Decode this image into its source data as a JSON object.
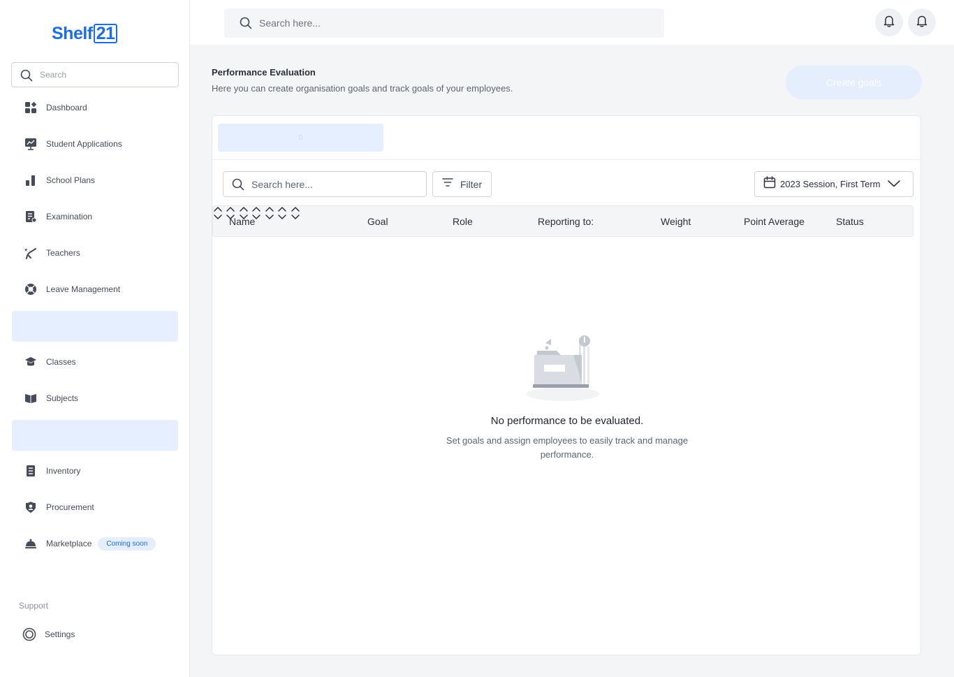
{
  "app": {
    "logo_text": "Shelf",
    "logo_box": "21"
  },
  "sidebar": {
    "search_placeholder": "Search",
    "items": [
      {
        "label": "Dashboard"
      },
      {
        "label": "Student Applications"
      },
      {
        "label": "School Plans"
      },
      {
        "label": "Examination"
      },
      {
        "label": "Teachers"
      },
      {
        "label": "Leave Management"
      },
      {
        "label": "Classes"
      },
      {
        "label": "Subjects"
      },
      {
        "label": "Inventory"
      },
      {
        "label": "Procurement"
      },
      {
        "label": "Marketplace",
        "badge": "Coming soon"
      }
    ],
    "support_label": "Support",
    "settings_label": "Settings"
  },
  "topbar": {
    "search_placeholder": "Search here..."
  },
  "page": {
    "title": "Performance Evaluation",
    "subtitle": "Here you can create organisation goals and track goals of your employees.",
    "create_button": "Create goals"
  },
  "card": {
    "tab_label": "0",
    "search_placeholder": "Search here...",
    "filter_label": "Filter",
    "session_label": "2023 Session, First Term",
    "columns": [
      "Name",
      "Goal",
      "Role",
      "Reporting to:",
      "Weight",
      "Point Average",
      "Status"
    ],
    "empty_title": "No performance to be evaluated.",
    "empty_subtitle": "Set goals and assign employees  to easily track and manage performance."
  },
  "colors": {
    "accent": "#1d6de5",
    "active_bg": "#e6efff",
    "page_bg": "#f4f5f7"
  }
}
